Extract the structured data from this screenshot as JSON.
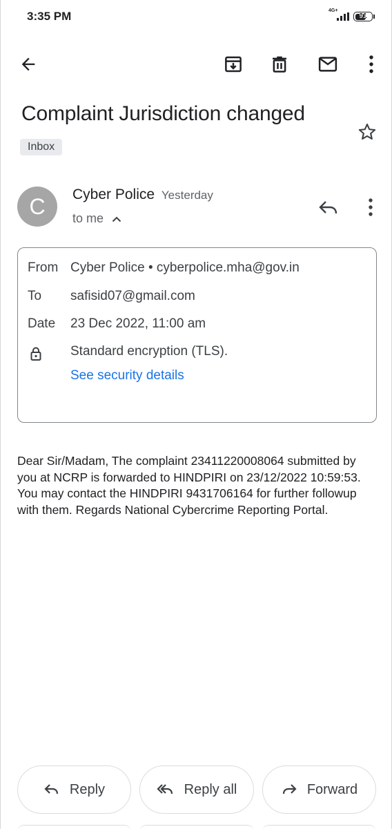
{
  "status_bar": {
    "time": "3:35 PM",
    "network": "4G+",
    "battery": "91"
  },
  "toolbar": {
    "back_icon": "arrow-back-icon",
    "archive_icon": "archive-icon",
    "delete_icon": "trash-icon",
    "mark_unread_icon": "mail-icon",
    "more_icon": "more-vert-icon"
  },
  "email": {
    "subject": "Complaint Jurisdiction changed",
    "label": "Inbox",
    "sender": {
      "initial": "C",
      "name": "Cyber Police",
      "date": "Yesterday",
      "recipient_summary": "to me"
    },
    "details": {
      "from_label": "From",
      "from_value": "Cyber Police • cyberpolice.mha@gov.in",
      "to_label": "To",
      "to_value": "safisid07@gmail.com",
      "date_label": "Date",
      "date_value": "23 Dec 2022, 11:00 am",
      "encryption": "Standard encryption (TLS).",
      "security_link": "See security details"
    },
    "body": "Dear Sir/Madam, The complaint 23411220008064 submitted by you at NCRP is forwarded to HINDPIRI on 23/12/2022 10:59:53. You may contact the HINDPIRI 9431706164 for further followup with them. Regards National Cybercrime Reporting Portal."
  },
  "actions": {
    "reply": "Reply",
    "reply_all": "Reply all",
    "forward": "Forward"
  },
  "colors": {
    "accent_link": "#1a73e8",
    "avatar_bg": "#a6a6a6",
    "text_primary": "#202124",
    "text_secondary": "#5f6368"
  }
}
